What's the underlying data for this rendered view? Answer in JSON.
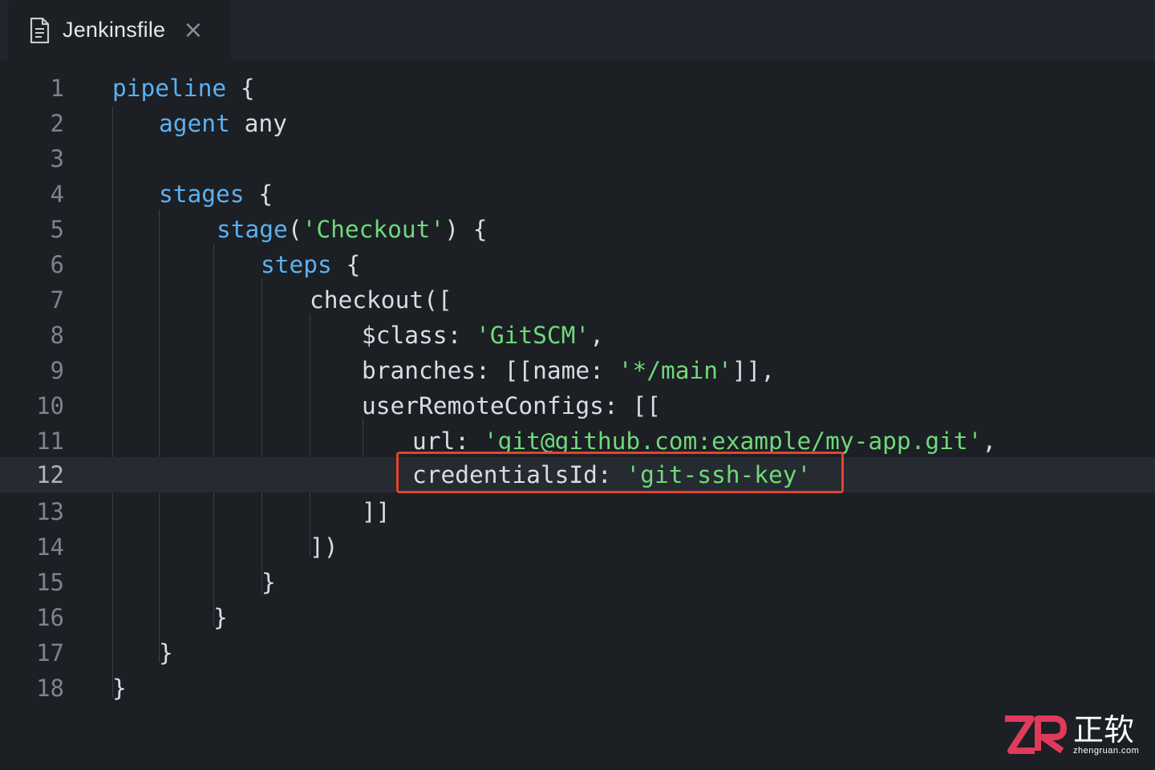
{
  "tab": {
    "title": "Jenkinsfile",
    "close_glyph": "×",
    "icon": "file-icon"
  },
  "editor": {
    "active_line": 12,
    "lines": [
      {
        "num": "1",
        "tokens": [
          {
            "t": "kw",
            "v": "pipeline"
          },
          {
            "t": "p",
            "v": " {"
          }
        ]
      },
      {
        "num": "2",
        "tokens": [
          {
            "t": "kw",
            "v": "agent"
          },
          {
            "t": "p",
            "v": " any"
          }
        ]
      },
      {
        "num": "3",
        "tokens": []
      },
      {
        "num": "4",
        "tokens": [
          {
            "t": "kw",
            "v": "stages"
          },
          {
            "t": "p",
            "v": " {"
          }
        ]
      },
      {
        "num": "5",
        "tokens": [
          {
            "t": "kw",
            "v": "stage"
          },
          {
            "t": "p",
            "v": "("
          },
          {
            "t": "str",
            "v": "'Checkout'"
          },
          {
            "t": "p",
            "v": ") {"
          }
        ]
      },
      {
        "num": "6",
        "tokens": [
          {
            "t": "kw",
            "v": "steps"
          },
          {
            "t": "p",
            "v": " {"
          }
        ]
      },
      {
        "num": "7",
        "tokens": [
          {
            "t": "p",
            "v": "checkout(["
          }
        ]
      },
      {
        "num": "8",
        "tokens": [
          {
            "t": "p",
            "v": "$class: "
          },
          {
            "t": "str",
            "v": "'GitSCM'"
          },
          {
            "t": "p",
            "v": ","
          }
        ]
      },
      {
        "num": "9",
        "tokens": [
          {
            "t": "p",
            "v": "branches: [[name: "
          },
          {
            "t": "str",
            "v": "'*/main'"
          },
          {
            "t": "p",
            "v": "]],"
          }
        ]
      },
      {
        "num": "10",
        "tokens": [
          {
            "t": "p",
            "v": "userRemoteConfigs: [["
          }
        ]
      },
      {
        "num": "11",
        "tokens": [
          {
            "t": "p",
            "v": "url: "
          },
          {
            "t": "str",
            "v": "'git@github.com:example/my-app.git'"
          },
          {
            "t": "p",
            "v": ","
          }
        ]
      },
      {
        "num": "12",
        "tokens": [
          {
            "t": "p",
            "v": "credentialsId: "
          },
          {
            "t": "str",
            "v": "'git-ssh-key'"
          }
        ]
      },
      {
        "num": "13",
        "tokens": [
          {
            "t": "p",
            "v": "]]"
          }
        ]
      },
      {
        "num": "14",
        "tokens": [
          {
            "t": "p",
            "v": "])"
          }
        ]
      },
      {
        "num": "15",
        "tokens": [
          {
            "t": "p",
            "v": "}"
          }
        ]
      },
      {
        "num": "16",
        "tokens": [
          {
            "t": "p",
            "v": "}"
          }
        ]
      },
      {
        "num": "17",
        "tokens": [
          {
            "t": "p",
            "v": "}"
          }
        ]
      },
      {
        "num": "18",
        "tokens": [
          {
            "t": "p",
            "v": "}"
          }
        ]
      }
    ]
  },
  "colors": {
    "background": "#1c1f24",
    "keyword": "#5cb1f0",
    "string": "#6fd97a",
    "plain": "#d9dde3",
    "line_number": "#7d838c",
    "highlight_border": "#e5432f"
  },
  "watermark": {
    "chinese": "正软",
    "url": "zhengruan.com",
    "logo_text": "ZR"
  }
}
